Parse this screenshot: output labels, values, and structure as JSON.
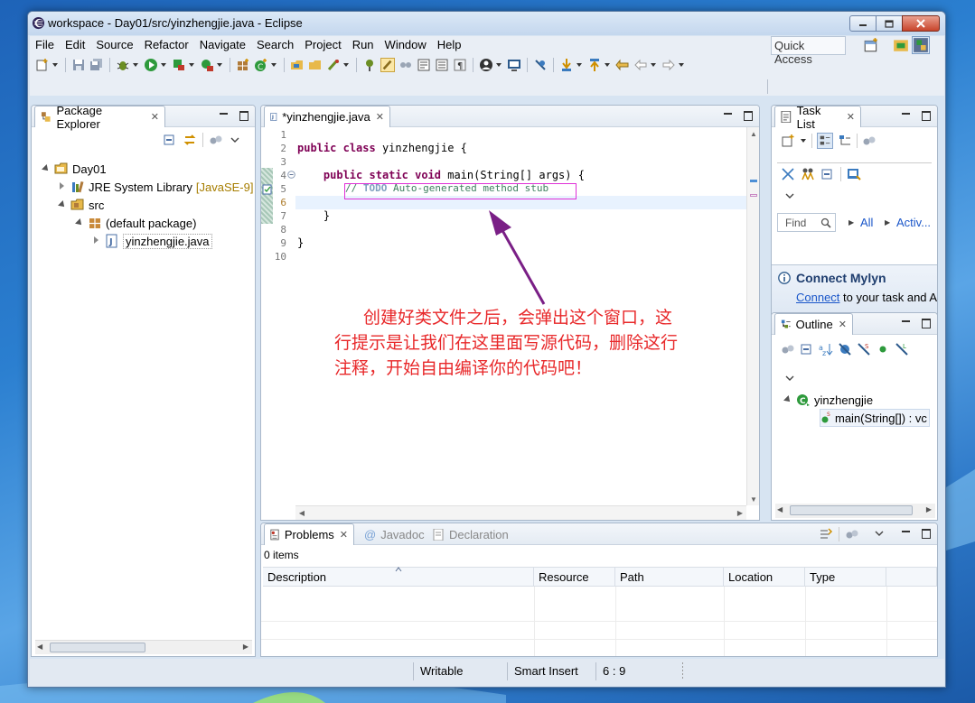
{
  "window": {
    "title": "workspace - Day01/src/yinzhengjie.java - Eclipse",
    "controls": [
      "minimize",
      "maximize",
      "close"
    ]
  },
  "menubar": [
    "File",
    "Edit",
    "Source",
    "Refactor",
    "Navigate",
    "Search",
    "Project",
    "Run",
    "Window",
    "Help"
  ],
  "toolbar": {
    "quick_access": "Quick Access"
  },
  "package_explorer": {
    "tab_label": "Package Explorer",
    "tree": {
      "project": "Day01",
      "jre_library": "JRE System Library",
      "jre_version": "[JavaSE-9]",
      "src": "src",
      "package": "(default package)",
      "file": "yinzhengjie.java"
    }
  },
  "editor": {
    "tab_label": "*yinzhengjie.java",
    "line_numbers": [
      "1",
      "2",
      "3",
      "4",
      "5",
      "6",
      "7",
      "8",
      "9",
      "10"
    ],
    "lines": {
      "l2_kw1": "public",
      "l2_kw2": "class",
      "l2_rest": " yinzhengjie {",
      "l4_kw1": "public",
      "l4_kw2": "static",
      "l4_kw3": "void",
      "l4_rest": " main(String[] args) {",
      "l5_comment_prefix": "// ",
      "l5_comment_tag": "TODO",
      "l5_comment_rest": " Auto-generated method stub",
      "l7": "}",
      "l9": "}"
    },
    "annotation": "创建好类文件之后，会弹出这个窗口，这行提示是让我们在这里面写源代码，删除这行注释，开始自由编译你的代码吧！",
    "annotation_color": "#e8282a"
  },
  "task_list": {
    "tab_label": "Task List",
    "find_placeholder": "Find",
    "filter_all": "All",
    "filter_active": "Activ..."
  },
  "mylyn": {
    "title": "Connect Mylyn",
    "link": "Connect",
    "text": " to your task and A"
  },
  "outline": {
    "tab_label": "Outline",
    "class_name": "yinzhengjie",
    "method": "main(String[]) : vc"
  },
  "problems": {
    "tabs": {
      "problems": "Problems",
      "javadoc": "Javadoc",
      "declaration": "Declaration"
    },
    "count": "0 items",
    "columns": [
      "Description",
      "Resource",
      "Path",
      "Location",
      "Type"
    ]
  },
  "statusbar": {
    "writable": "Writable",
    "insert_mode": "Smart Insert",
    "position": "6 : 9"
  }
}
